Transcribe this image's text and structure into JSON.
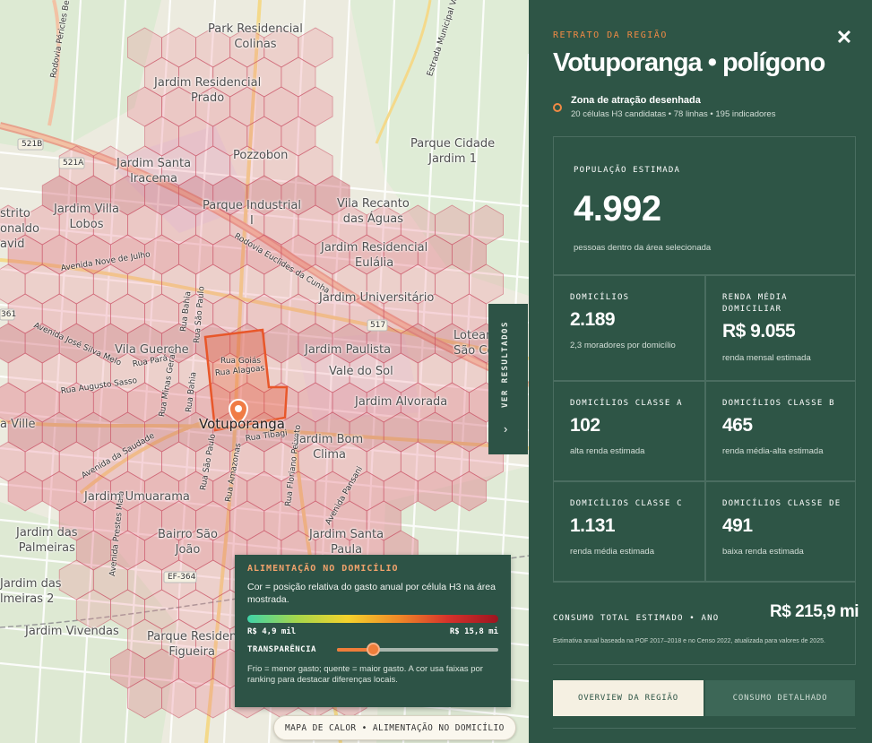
{
  "map": {
    "neighborhoods": [
      {
        "id": "park-residencial-colinas",
        "lines": [
          "Park Residencial",
          "Colinas"
        ]
      },
      {
        "id": "jardim-residencial-prado",
        "lines": [
          "Jardim Residencial",
          "Prado"
        ]
      },
      {
        "id": "pozzobon",
        "lines": [
          "Pozzobon"
        ]
      },
      {
        "id": "jardim-santa-iracema",
        "lines": [
          "Jardim Santa",
          "Iracema"
        ]
      },
      {
        "id": "parque-cidade-jardim",
        "lines": [
          "Parque Cidade",
          "Jardim 1"
        ]
      },
      {
        "id": "parque-industrial",
        "lines": [
          "Parque Industrial",
          "I"
        ]
      },
      {
        "id": "vila-recanto",
        "lines": [
          "Vila Recanto",
          "das Águas"
        ]
      },
      {
        "id": "jardim-villa-lobos",
        "lines": [
          "Jardim Villa",
          "Lobos"
        ]
      },
      {
        "id": "jardim-residencial-eulalia",
        "lines": [
          "Jardim Residencial",
          "Eulália"
        ]
      },
      {
        "id": "jardim-universitario",
        "lines": [
          "Jardim Universitário"
        ]
      },
      {
        "id": "vila-guerche",
        "lines": [
          "Vila Guerche"
        ]
      },
      {
        "id": "jardim-paulista",
        "lines": [
          "Jardim Paulista"
        ]
      },
      {
        "id": "vale-do-sol",
        "lines": [
          "Vale do Sol"
        ]
      },
      {
        "id": "loteamento-sao-cosme",
        "lines": [
          "Loteamen",
          "São Cosm"
        ]
      },
      {
        "id": "jardim-alvorada",
        "lines": [
          "Jardim Alvorada"
        ]
      },
      {
        "id": "jardim-bom-clima",
        "lines": [
          "Jardim Bom",
          "Clima"
        ]
      },
      {
        "id": "jardim-umuarama",
        "lines": [
          "Jardim Umuarama"
        ]
      },
      {
        "id": "bairro-sao-joao",
        "lines": [
          "Bairro São",
          "João"
        ]
      },
      {
        "id": "jardim-santa-paula",
        "lines": [
          "Jardim Santa",
          "Paula"
        ]
      },
      {
        "id": "jardim-das-palmeiras",
        "lines": [
          "Jardim das",
          "Palmeiras"
        ]
      },
      {
        "id": "jardim-das-palmeiras-2",
        "lines": [
          "Jardim das",
          "lmeiras 2"
        ]
      },
      {
        "id": "jardim-vivendas",
        "lines": [
          "Jardim Vivendas"
        ]
      },
      {
        "id": "parque-residencial-figueira",
        "lines": [
          "Parque Residen",
          "Figueira"
        ]
      },
      {
        "id": "edge-cristo",
        "lines": [
          "strito",
          "onaldo",
          "avid"
        ]
      },
      {
        "id": "edge-ville",
        "lines": [
          "a Ville"
        ]
      }
    ],
    "streets": {
      "rodovia_euclides": "Rodovia Euclides da Cunha",
      "rodovia_pericles": "Rodovia Péricles Bellin",
      "estrada_municipal": "Estrada Municipal Vo",
      "av_nove_julho": "Avenida Nove de Julho",
      "av_jose_silva_melo": "Avenida José Silva Melo",
      "rua_augusto_sasso": "Rua Augusto Sasso",
      "rua_para": "Rua Pará",
      "rua_minas_gerais": "Rua Minas Gerais",
      "rua_bahia": "Rua Bahia",
      "rua_bahia_2": "Rua Bahia",
      "rua_sao_paulo": "Rua São Paulo",
      "rua_goias": "Rua Goiás",
      "rua_alagoas": "Rua Alagoas",
      "rua_tibagi": "Rua Tibagi",
      "rua_amazonas": "Rua Amazonas",
      "rua_sao_paulo_2": "Rua São Paulo",
      "rua_floriano_peixoto": "Rua Floriano Peixoto",
      "av_saudade": "Avenida da Saudade",
      "av_prestes_maia": "Avenida Prestes Maia",
      "rua_pansani": "Avenida Pansani",
      "shield_521b": "521B",
      "shield_521a": "521A",
      "shield_517": "517",
      "shield_361": "361",
      "shield_ef364": "EF-364"
    },
    "city_label": "Votuporanga"
  },
  "legend": {
    "title": "ALIMENTAÇÃO NO DOMICÍLIO",
    "description": "Cor = posição relativa do gasto anual por célula H3 na área mostrada.",
    "min_label": "R$ 4,9 mil",
    "max_label": "R$ 15,8 mi",
    "transparency_label": "TRANSPARÊNCIA",
    "transparency_value": 0.22,
    "footnote": "Frio = menor gasto; quente = maior gasto. A cor usa faixas por ranking para destacar diferenças locais."
  },
  "heatmap_chip": "MAPA DE CALOR • ALIMENTAÇÃO NO DOMICÍLIO",
  "results_tab": {
    "label": "VER RESULTADOS",
    "chevron": "›"
  },
  "panel": {
    "eyebrow": "RETRATO DA REGIÃO",
    "title": "Votuporanga • polígono",
    "close_glyph": "✕",
    "zone_title": "Zona de atração desenhada",
    "zone_sub": "20 células H3 candidatas • 78 linhas • 195 indicadores",
    "population": {
      "label": "POPULAÇÃO ESTIMADA",
      "value": "4.992",
      "sub": "pessoas dentro da área selecionada"
    },
    "domicilios": {
      "label": "DOMICÍLIOS",
      "value": "2.189",
      "sub": "2,3 moradores por domicílio"
    },
    "renda": {
      "label_1": "RENDA MÉDIA",
      "label_2": "DOMICILIAR",
      "value": "R$ 9.055",
      "sub": "renda mensal estimada"
    },
    "classe_a": {
      "label": "DOMICÍLIOS CLASSE A",
      "value": "102",
      "sub": "alta renda estimada"
    },
    "classe_b": {
      "label": "DOMICÍLIOS CLASSE B",
      "value": "465",
      "sub": "renda média-alta estimada"
    },
    "classe_c": {
      "label": "DOMICÍLIOS CLASSE C",
      "value": "1.131",
      "sub": "renda média estimada"
    },
    "classe_de": {
      "label": "DOMICÍLIOS CLASSE DE",
      "value": "491",
      "sub": "baixa renda estimada"
    },
    "consumo": {
      "label": "CONSUMO TOTAL ESTIMADO • ANO",
      "value": "R$ 215,9 mi",
      "note": "Estimativa anual baseada na POF 2017–2018 e no Censo 2022, atualizada para valores de 2025."
    },
    "tabs": {
      "overview": "OVERVIEW DA REGIÃO",
      "consumo": "CONSUMO DETALHADO"
    }
  },
  "colors": {
    "panel_bg": "#2e5546",
    "accent": "#f08a45",
    "polygon": "#e8572a",
    "hex_fill": "#e88a95"
  }
}
